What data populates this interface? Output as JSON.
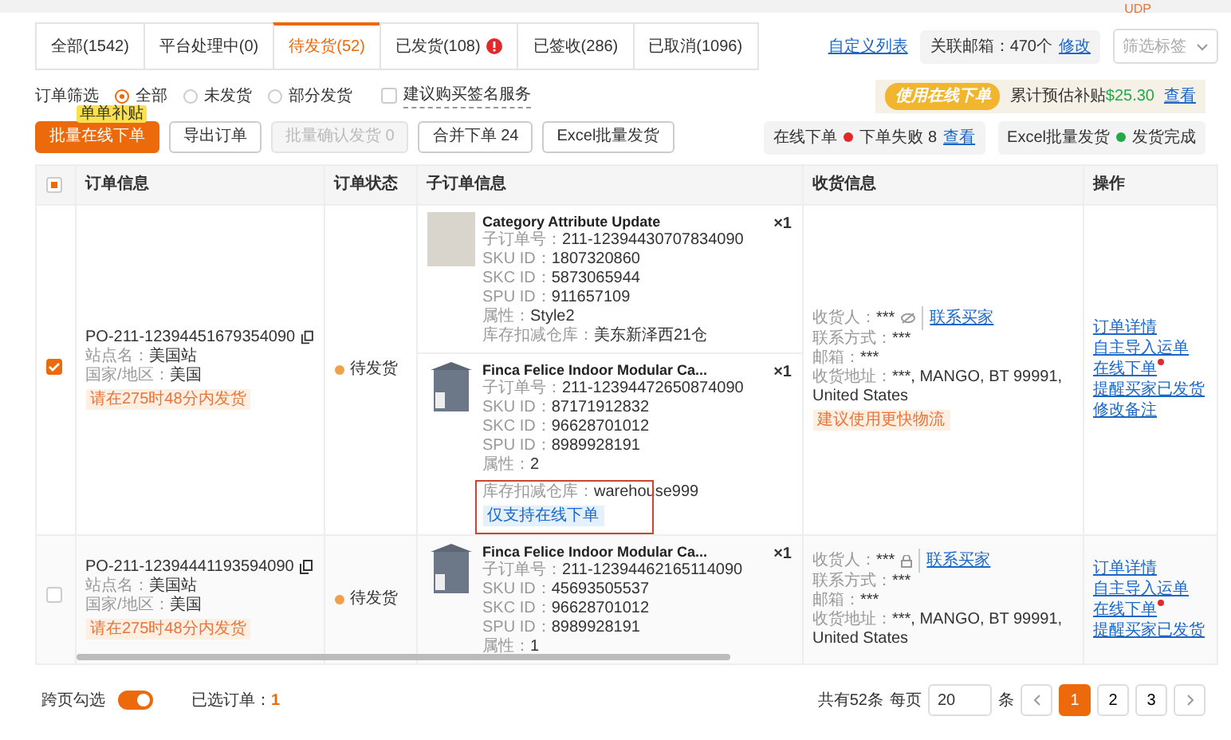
{
  "top_bar": {
    "badge": "UDP"
  },
  "tabs": [
    {
      "label": "全部(1542)",
      "selected": false,
      "alert": false
    },
    {
      "label": "平台处理中(0)",
      "selected": false,
      "alert": false
    },
    {
      "label": "待发货(52)",
      "selected": true,
      "alert": false
    },
    {
      "label": "已发货(108)",
      "selected": false,
      "alert": true
    },
    {
      "label": "已签收(286)",
      "selected": false,
      "alert": false
    },
    {
      "label": "已取消(1096)",
      "selected": false,
      "alert": false
    }
  ],
  "header_tools": {
    "custom_columns": "自定义列表",
    "mailbox_label": "关联邮箱：470个",
    "mailbox_edit": "修改",
    "tag_filter": {
      "placeholder": "筛选标签"
    }
  },
  "filter": {
    "label": "订单筛选",
    "options": [
      {
        "label": "全部",
        "selected": true
      },
      {
        "label": "未发货",
        "selected": false
      },
      {
        "label": "部分发货",
        "selected": false
      }
    ],
    "sign_service": {
      "label": "建议购买签名服务",
      "checked": false
    }
  },
  "promo": {
    "banner": "使用在线下单",
    "text": "累计预估补贴",
    "amount": "$25.30",
    "link": "查看"
  },
  "actions": [
    {
      "label": "批量在线下单",
      "kind": "primary",
      "tooltip": "单单补贴"
    },
    {
      "label": "导出订单",
      "kind": "default"
    },
    {
      "label": "批量确认发货 0",
      "kind": "disabled"
    },
    {
      "label": "合并下单  24",
      "kind": "default"
    },
    {
      "label": "Excel批量发货",
      "kind": "default"
    }
  ],
  "status_chips": [
    {
      "label": "在线下单",
      "color": "#e02a2a",
      "text": "下单失败 8",
      "link": "查看"
    },
    {
      "label": "Excel批量发货",
      "color": "#23a84a",
      "text": "发货完成"
    }
  ],
  "table": {
    "indeterminate": true,
    "columns": [
      "订单信息",
      "订单状态",
      "子订单信息",
      "收货信息",
      "操作"
    ],
    "rows": [
      {
        "checked": true,
        "order_no": "PO-211-12394451679354090",
        "site_label": "站点名：",
        "site": "美国站",
        "region_label": "国家/地区：",
        "region": "美国",
        "deadline": "请在275时48分内发货",
        "status": "待发货",
        "items": [
          {
            "kind": "photo",
            "title": "Category Attribute Update",
            "quantity": "×1",
            "highlighted": false,
            "fields": [
              {
                "label": "子订单号：",
                "value": "211-12394430707834090"
              },
              {
                "label": "SKU ID：",
                "value": "1807320860"
              },
              {
                "label": "SKC ID：",
                "value": "5873065944"
              },
              {
                "label": "SPU ID：",
                "value": "911657109"
              },
              {
                "label": "属性：",
                "value": "Style2"
              },
              {
                "label": "库存扣减仓库：",
                "value": "美东新泽西21仓"
              }
            ]
          },
          {
            "kind": "cabinet",
            "title": "Finca Felice Indoor Modular Ca...",
            "quantity": "×1",
            "highlighted": true,
            "tag": "仅支持在线下单",
            "fields": [
              {
                "label": "子订单号：",
                "value": "211-12394472650874090"
              },
              {
                "label": "SKU ID：",
                "value": "87171912832"
              },
              {
                "label": "SKC ID：",
                "value": "96628701012"
              },
              {
                "label": "SPU ID：",
                "value": "8989928191"
              },
              {
                "label": "属性：",
                "value": "2"
              },
              {
                "label": "库存扣减仓库：",
                "value": "warehouse999"
              }
            ]
          }
        ],
        "receiver": {
          "name_label": "收货人：",
          "name": "***",
          "locked": false,
          "contact": "联系买家",
          "fields": [
            {
              "label": "联系方式：",
              "value": "***"
            },
            {
              "label": "邮箱：",
              "value": "***"
            },
            {
              "label": "收货地址：",
              "value": "***, MANGO, BT 99991, United States"
            }
          ],
          "tag": "建议使用更快物流"
        },
        "ops": [
          {
            "label": "订单详情",
            "dot": false
          },
          {
            "label": "自主导入运单",
            "dot": false
          },
          {
            "label": "在线下单",
            "dot": true
          },
          {
            "label": "提醒买家已发货",
            "dot": false
          },
          {
            "label": "修改备注",
            "dot": false
          }
        ]
      },
      {
        "checked": false,
        "order_no": "PO-211-12394441193594090",
        "site_label": "站点名：",
        "site": "美国站",
        "region_label": "国家/地区：",
        "region": "美国",
        "deadline": "请在275时48分内发货",
        "status": "待发货",
        "items": [
          {
            "kind": "cabinet",
            "title": "Finca Felice Indoor Modular Ca...",
            "quantity": "×1",
            "highlighted": false,
            "fields": [
              {
                "label": "子订单号：",
                "value": "211-12394462165114090"
              },
              {
                "label": "SKU ID：",
                "value": "45693505537"
              },
              {
                "label": "SKC ID：",
                "value": "96628701012"
              },
              {
                "label": "SPU ID：",
                "value": "8989928191"
              },
              {
                "label": "属性：",
                "value": "1"
              }
            ]
          }
        ],
        "receiver": {
          "name_label": "收货人：",
          "name": "***",
          "locked": true,
          "contact": "联系买家",
          "fields": [
            {
              "label": "联系方式：",
              "value": "***"
            },
            {
              "label": "邮箱：",
              "value": "***"
            },
            {
              "label": "收货地址：",
              "value": "***, MANGO, BT 99991, United States"
            }
          ]
        },
        "ops": [
          {
            "label": "订单详情",
            "dot": false
          },
          {
            "label": "自主导入运单",
            "dot": false
          },
          {
            "label": "在线下单",
            "dot": true
          },
          {
            "label": "提醒买家已发货",
            "dot": false
          }
        ]
      }
    ]
  },
  "footer": {
    "cross_page": {
      "label": "跨页勾选",
      "on": true
    },
    "selected_label": "已选订单：",
    "selected_count": "1",
    "total": "共有52条",
    "per_page": "每页",
    "page_size": "20",
    "unit": "条",
    "pages": [
      {
        "label": "1",
        "selected": true
      },
      {
        "label": "2",
        "selected": false
      },
      {
        "label": "3",
        "selected": false
      }
    ]
  }
}
